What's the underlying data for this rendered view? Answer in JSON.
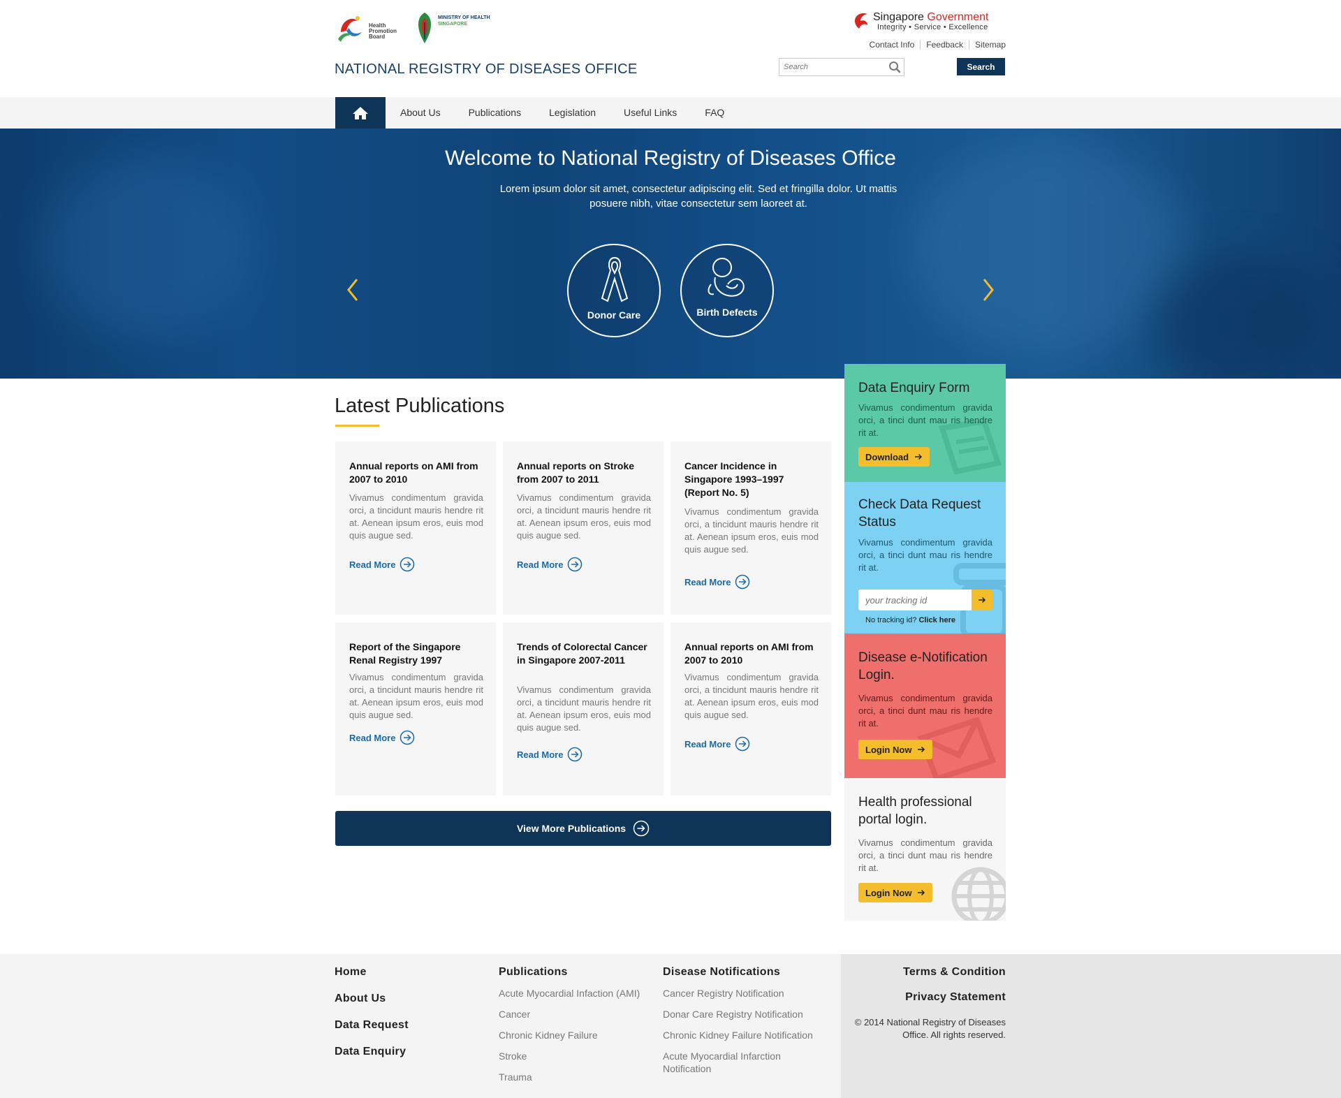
{
  "header": {
    "hpb_logo_text": "Health Promotion Board",
    "moh_logo_line1": "MINISTRY OF HEALTH",
    "moh_logo_line2": "SINGAPORE",
    "site_title": "NATIONAL REGISTRY OF DISEASES OFFICE",
    "gov_line1_a": "Singapore ",
    "gov_line1_b": "Government",
    "gov_line2": "Integrity • Service • Excellence",
    "util_links": [
      "Contact Info",
      "Feedback",
      "Sitemap"
    ],
    "search_placeholder": "Search",
    "search_button": "Search"
  },
  "nav": {
    "items": [
      "About Us",
      "Publications",
      "Legislation",
      "Useful Links",
      "FAQ"
    ]
  },
  "hero": {
    "title": "Welcome to National Registry of Diseases Office",
    "subtitle": "Lorem ipsum dolor sit amet, consectetur adipiscing elit. Sed et fringilla dolor. Ut mattis posuere nibh, vitae consectetur sem laoreet at.",
    "circles": [
      "Donor Care",
      "Birth Defects"
    ]
  },
  "publications": {
    "title": "Latest Publications",
    "read_more": "Read More",
    "view_more": "View More Publications",
    "cards": [
      {
        "title": "Annual reports on AMI from 2007 to 2010",
        "desc": "Vivamus condimentum gravida orci, a tincidunt mauris hendre rit at. Aenean ipsum eros, euis mod quis augue sed."
      },
      {
        "title": "Annual reports on Stroke from 2007 to 2011",
        "desc": "Vivamus condimentum gravida orci, a tincidunt mauris hendre rit at. Aenean ipsum eros, euis mod quis augue sed."
      },
      {
        "title": "Cancer Incidence in Singapore 1993–1997 (Report No. 5)",
        "desc": "Vivamus condimentum gravida orci, a tincidunt mauris hendre rit at. Aenean ipsum eros, euis mod quis augue sed."
      },
      {
        "title": "Report of the Singapore Renal Registry 1997",
        "desc": "Vivamus condimentum gravida orci, a tincidunt mauris hendre rit at. Aenean ipsum eros, euis mod quis augue sed."
      },
      {
        "title": "Trends of Colorectal Cancer in Singapore 2007-2011",
        "desc": "Vivamus condimentum gravida orci, a tincidunt mauris hendre rit at. Aenean ipsum eros, euis mod quis augue sed."
      },
      {
        "title": "Annual reports on AMI from 2007 to 2010",
        "desc": "Vivamus condimentum gravida orci, a tincidunt mauris hendre rit at. Aenean ipsum eros, euis mod quis augue sed."
      }
    ]
  },
  "sidebar": {
    "enquiry": {
      "title": "Data Enquiry Form",
      "desc": "Vivamus condimentum gravida orci, a tinci dunt mau ris hendre rit at.",
      "button": "Download",
      "color": "#5bc9a8"
    },
    "status": {
      "title": "Check Data Request Status",
      "desc": "Vivamus condimentum gravida orci, a tinci dunt mau ris hendre rit at.",
      "input_placeholder": "your tracking id",
      "note": "No tracking id?",
      "note_link": "Click here",
      "color": "#7dd2f3"
    },
    "notification": {
      "title": "Disease e-Notification Login.",
      "desc": "Vivamus condimentum gravida orci, a tinci dunt mau ris hendre rit at.",
      "button": "Login Now",
      "color": "#ef6f6c"
    },
    "portal": {
      "title": "Health professional portal login.",
      "desc": "Vivamus condimentum gravida orci, a tinci dunt mau ris hendre rit at.",
      "button": "Login Now",
      "color": "#f6f6f6"
    }
  },
  "footer": {
    "col1": [
      "Home",
      "About Us",
      "Data Request",
      "Data Enquiry"
    ],
    "col2_head": "Publications",
    "col2": [
      "Acute Myocardial Infaction (AMI)",
      "Cancer",
      "Chronic Kidney Failure",
      "Stroke",
      "Trauma"
    ],
    "col3_head": "Disease Notifications",
    "col3": [
      "Cancer Registry Notification",
      "Donar Care Registry Notification",
      "Chronic Kidney Failure Notification",
      "Acute Myocardial Infarction Notification"
    ],
    "terms": "Terms & Condition",
    "privacy": "Privacy Statement",
    "copyright": "© 2014 National Registry of Diseases Office. All rights reserved."
  },
  "colors": {
    "navy": "#0e3558",
    "accent_yellow": "#f4bd2c",
    "link_blue": "#1b6aa7"
  }
}
